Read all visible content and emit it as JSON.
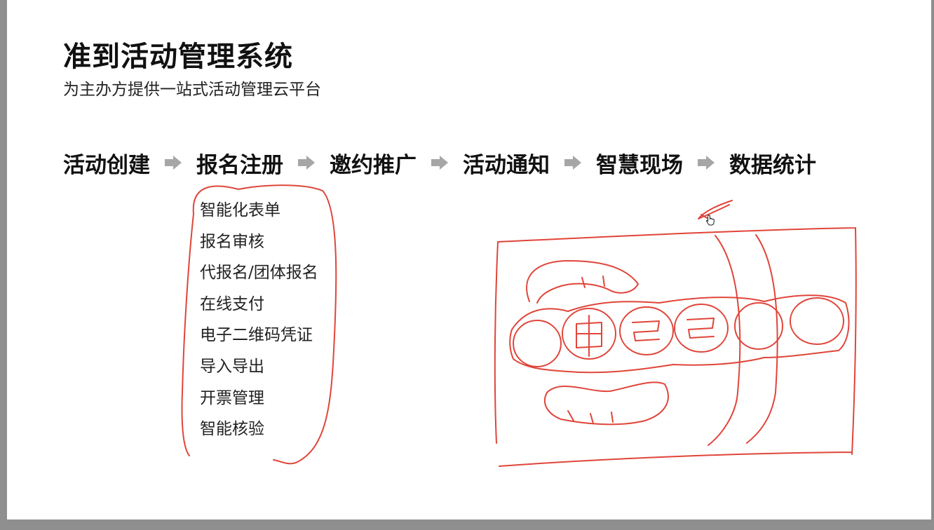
{
  "slide": {
    "title": "准到活动管理系统",
    "subtitle": "为主办方提供一站式活动管理云平台"
  },
  "flow": {
    "steps": [
      "活动创建",
      "报名注册",
      "邀约推广",
      "活动通知",
      "智慧现场",
      "数据统计"
    ],
    "arrow_icon": "right-arrow-icon",
    "arrow_color": "#a6a6a6"
  },
  "registration_features": [
    "智能化表单",
    "报名审核",
    "代报名/团体报名",
    "在线支付",
    "电子二维码凭证",
    "导入导出",
    "开票管理",
    "智能核验"
  ],
  "annotation": {
    "stroke_color": "#e0453a",
    "cursor_icon": "hand-pointer-icon"
  }
}
